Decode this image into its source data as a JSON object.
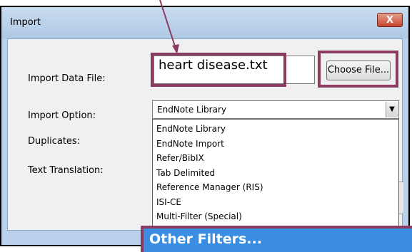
{
  "dialog": {
    "title": "Import",
    "close_label": "X"
  },
  "form": {
    "import_file_label": "Import Data File:",
    "import_file_value": "heart disease.txt",
    "choose_file_label": "Choose File...",
    "import_option_label": "Import Option:",
    "import_option_selected": "EndNote Library",
    "duplicates_label": "Duplicates:",
    "text_translation_label": "Text Translation:"
  },
  "dropdown": {
    "items": [
      "EndNote Library",
      "EndNote Import",
      "Refer/BibIX",
      "Tab Delimited",
      "Reference Manager (RIS)",
      "ISI-CE",
      "Multi-Filter (Special)"
    ],
    "highlighted_item": "Other Filters..."
  },
  "colors": {
    "annotation": "#8b3a62",
    "selection": "#3a8de0",
    "frame": "#b9d1ea"
  },
  "icons": {
    "dropdown_arrow": "chevron-down-icon",
    "close": "close-icon"
  }
}
